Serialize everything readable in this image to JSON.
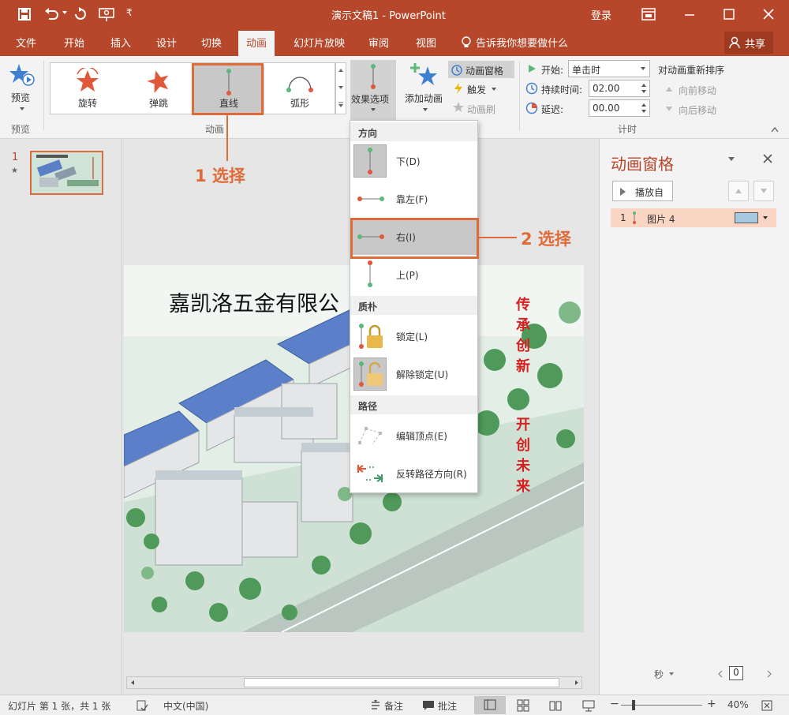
{
  "titlebar": {
    "document_title": "演示文稿1 - PowerPoint",
    "login": "登录",
    "qat_more": "₹"
  },
  "tabs": [
    "文件",
    "开始",
    "插入",
    "设计",
    "切换",
    "动画",
    "幻灯片放映",
    "审阅",
    "视图"
  ],
  "active_tab": "动画",
  "tell_me": "告诉我你想要做什么",
  "share": "共享",
  "ribbon": {
    "preview_label": "预览",
    "preview_group": "预览",
    "animation_group": "动画",
    "gallery": [
      {
        "label": "旋转",
        "name": "rotate"
      },
      {
        "label": "弹跳",
        "name": "bounce"
      },
      {
        "label": "直线",
        "name": "line"
      },
      {
        "label": "弧形",
        "name": "arc"
      }
    ],
    "effect_options": "效果选项",
    "add_animation": "添加动画",
    "animation_pane_btn": "动画窗格",
    "trigger": "触发",
    "painter": "动画刷",
    "start_label": "开始:",
    "start_value": "单击时",
    "duration_label": "持续时间:",
    "duration_value": "02.00",
    "delay_label": "延迟:",
    "delay_value": "00.00",
    "reorder_title": "对动画重新排序",
    "move_earlier": "向前移动",
    "move_later": "向后移动",
    "timing_group": "计时"
  },
  "dropdown": {
    "direction_header": "方向",
    "items_dir": [
      {
        "label": "下(D)",
        "name": "down"
      },
      {
        "label": "靠左(F)",
        "name": "left"
      },
      {
        "label": "右(I)",
        "name": "right"
      },
      {
        "label": "上(P)",
        "name": "up"
      }
    ],
    "texture_header": "质朴",
    "lock": "锁定(L)",
    "unlock": "解除锁定(U)",
    "path_header": "路径",
    "edit_points": "编辑顶点(E)",
    "reverse": "反转路径方向(R)"
  },
  "callouts": {
    "first": "1 选择",
    "second": "2 选择"
  },
  "thumbnail": {
    "number": "1",
    "star": "★"
  },
  "slide": {
    "title": "嘉凯洛五金有限公",
    "vertical_text_1": [
      "传",
      "承",
      "创",
      "新"
    ],
    "vertical_text_2": [
      "开",
      "创",
      "未",
      "来"
    ]
  },
  "anim_pane": {
    "title": "动画窗格",
    "play_from": "播放自",
    "item_number": "1",
    "item_label": "图片 4",
    "seconds": "秒",
    "zoom_value": "0"
  },
  "statusbar": {
    "slide_info": "幻灯片 第 1 张，共 1 张",
    "language": "中文(中国)",
    "notes": "备注",
    "comments": "批注",
    "zoom": "40%"
  },
  "colors": {
    "brand": "#b7472a",
    "accent": "#e06b3a",
    "selection": "#c8c8c8",
    "pane_item": "#fbd5c4"
  }
}
